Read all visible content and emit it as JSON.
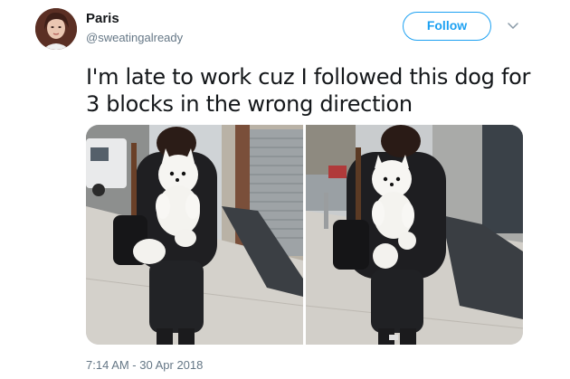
{
  "tweet": {
    "author_name": "Paris",
    "author_handle": "@sweatingalready",
    "follow_label": "Follow",
    "text": "I'm late to work cuz I followed this dog for 3 blocks in the wrong direction",
    "timestamp": "7:14 AM - 30 Apr 2018"
  },
  "media": {
    "photos": [
      "dog-backpack-photo-left",
      "dog-backpack-photo-right"
    ]
  },
  "colors": {
    "accent": "#1da1f2",
    "text_primary": "#14171a",
    "text_secondary": "#657786"
  },
  "icons": [
    "avatar",
    "chevron-down-icon"
  ]
}
